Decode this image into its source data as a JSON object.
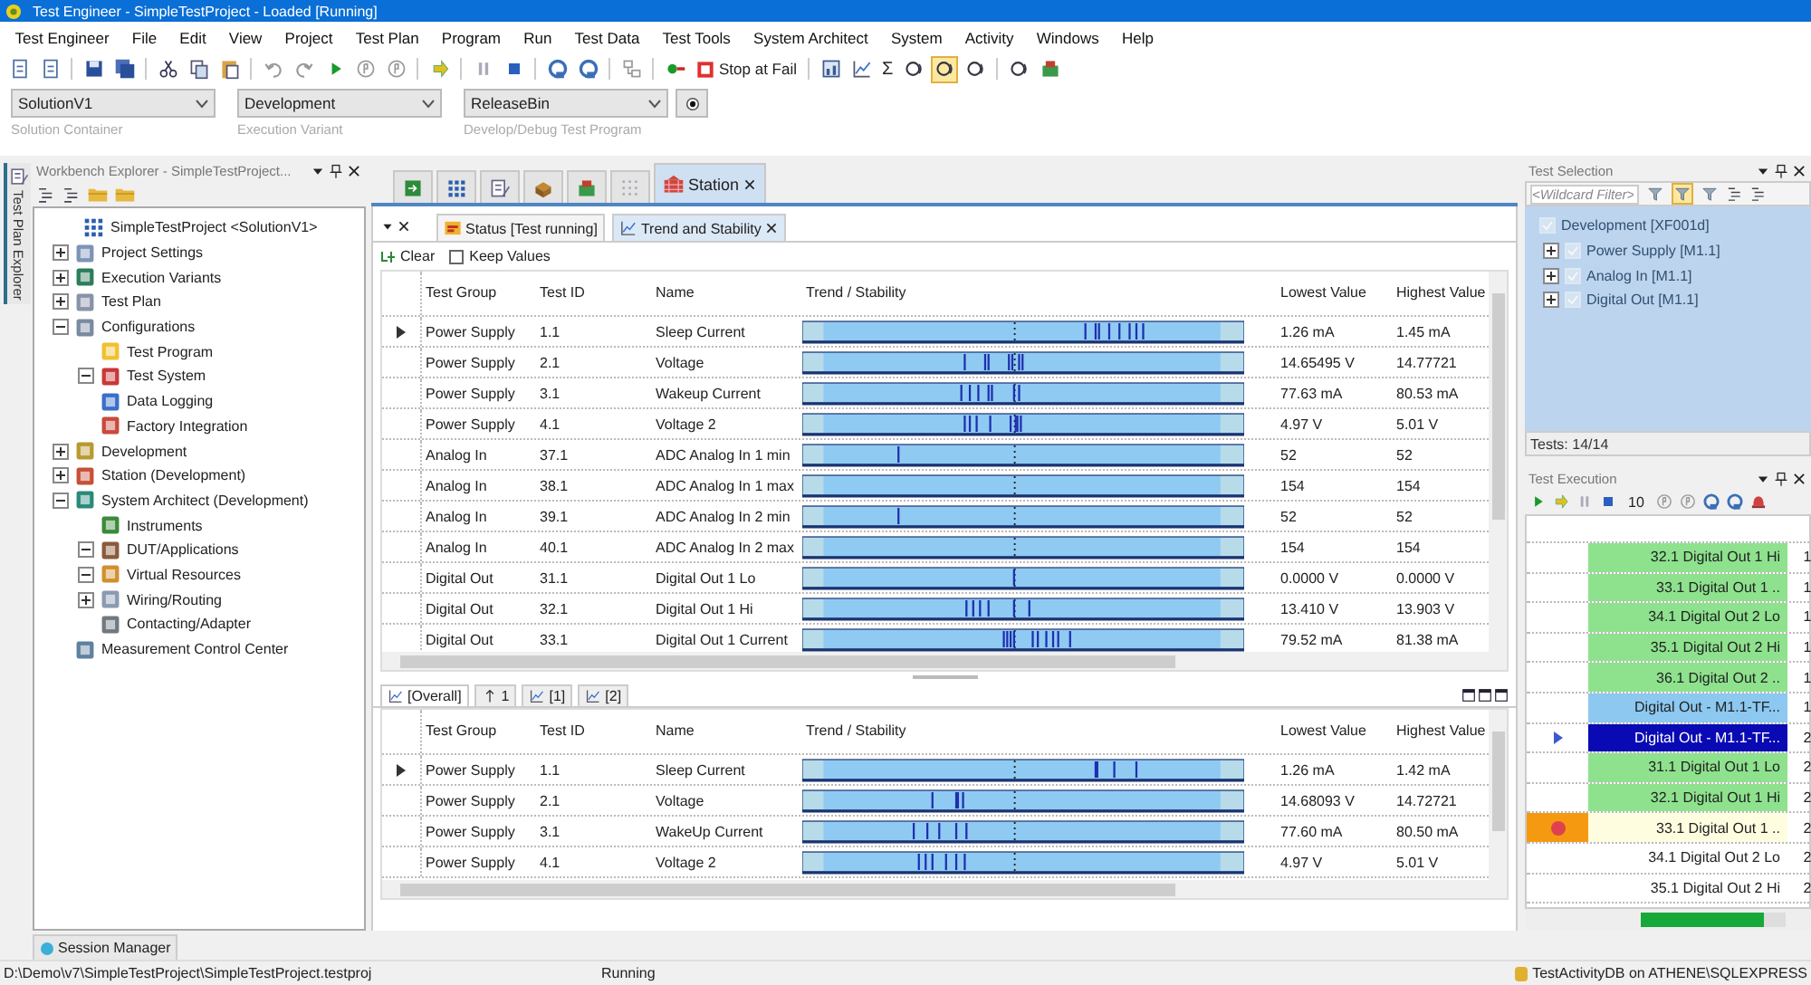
{
  "window": {
    "title": "Test Engineer - SimpleTestProject - Loaded [Running]"
  },
  "menu": [
    "Test Engineer",
    "File",
    "Edit",
    "View",
    "Project",
    "Test Plan",
    "Program",
    "Run",
    "Test Data",
    "Test Tools",
    "System Architect",
    "System",
    "Activity",
    "Windows",
    "Help"
  ],
  "toolbar": [
    {
      "kind": "doc"
    },
    {
      "kind": "doc"
    },
    {
      "kind": "sep"
    },
    {
      "kind": "save"
    },
    {
      "kind": "saveall"
    },
    {
      "kind": "sep"
    },
    {
      "kind": "cut"
    },
    {
      "kind": "copy"
    },
    {
      "kind": "paste"
    },
    {
      "kind": "sep"
    },
    {
      "kind": "undo"
    },
    {
      "kind": "redo"
    },
    {
      "kind": "play"
    },
    {
      "kind": "step"
    },
    {
      "kind": "step"
    },
    {
      "kind": "sep"
    },
    {
      "kind": "refresh"
    },
    {
      "kind": "sep"
    },
    {
      "kind": "pause"
    },
    {
      "kind": "stop"
    },
    {
      "kind": "sep"
    },
    {
      "kind": "loop"
    },
    {
      "kind": "loop"
    },
    {
      "kind": "sep"
    },
    {
      "kind": "deploy"
    },
    {
      "kind": "sep"
    },
    {
      "kind": "record"
    },
    {
      "kind": "stopfail",
      "label": "Stop at Fail"
    },
    {
      "kind": "sep"
    },
    {
      "kind": "chart"
    },
    {
      "kind": "graph"
    },
    {
      "kind": "text",
      "label": "Σ"
    },
    {
      "kind": "view",
      "pressed": false
    },
    {
      "kind": "view",
      "pressed": true
    },
    {
      "kind": "view",
      "pressed": false
    },
    {
      "kind": "sep"
    },
    {
      "kind": "view",
      "pressed": false
    },
    {
      "kind": "device"
    }
  ],
  "selectors": [
    {
      "value": "SolutionV1",
      "caption": "Solution Container"
    },
    {
      "value": "Development",
      "caption": "Execution Variant"
    },
    {
      "value": "ReleaseBin",
      "caption": "Develop/Debug Test Program"
    }
  ],
  "side_tab": "Test Plan Explorer",
  "explorer": {
    "title": "Workbench Explorer - SimpleTestProject...",
    "tree": [
      {
        "label": "SimpleTestProject <SolutionV1>",
        "kind": "grid",
        "children": [
          {
            "label": "Project Settings",
            "kind": "settings",
            "expanded": false
          },
          {
            "label": "Execution Variants",
            "kind": "variants",
            "expanded": false
          },
          {
            "label": "Test Plan",
            "kind": "plan",
            "expanded": false
          },
          {
            "label": "Configurations",
            "kind": "config",
            "expanded": true,
            "children": [
              {
                "label": "Test Program",
                "kind": "program"
              },
              {
                "label": "Test System",
                "kind": "system",
                "expanded": true
              },
              {
                "label": "Data Logging",
                "kind": "logging"
              },
              {
                "label": "Factory Integration",
                "kind": "factory"
              }
            ]
          },
          {
            "label": "Development",
            "kind": "dev",
            "expanded": false
          },
          {
            "label": "Station (Development)",
            "kind": "station",
            "expanded": false
          },
          {
            "label": "System Architect (Development)",
            "kind": "architect",
            "expanded": true,
            "children": [
              {
                "label": "Instruments",
                "kind": "instrument"
              },
              {
                "label": "DUT/Applications",
                "kind": "dut",
                "expanded": true
              },
              {
                "label": "Virtual Resources",
                "kind": "virtual",
                "expanded": true
              },
              {
                "label": "Wiring/Routing",
                "kind": "wiring",
                "expanded": false
              },
              {
                "label": "Contacting/Adapter",
                "kind": "adapter"
              }
            ]
          },
          {
            "label": "Measurement Control Center",
            "kind": "measure"
          }
        ]
      }
    ]
  },
  "doc_tabs": [
    {
      "kind": "import",
      "selected": false
    },
    {
      "kind": "grid",
      "selected": false
    },
    {
      "kind": "plan",
      "selected": false
    },
    {
      "kind": "box",
      "selected": false
    },
    {
      "kind": "device",
      "selected": false
    },
    {
      "kind": "dots",
      "selected": false
    },
    {
      "kind": "station",
      "label": "Station",
      "selected": true
    }
  ],
  "sub_tabs": [
    {
      "kind": "status",
      "label": "Status [Test running]",
      "selected": false
    },
    {
      "kind": "graph",
      "label": "Trend and Stability",
      "selected": true
    }
  ],
  "options": {
    "clear": "Clear",
    "keep_values": {
      "label": "Keep Values",
      "checked": false
    }
  },
  "columns": [
    "Test Group",
    "Test ID",
    "Name",
    "Trend / Stability",
    "Lowest Value",
    "Highest Value"
  ],
  "top_rows": [
    {
      "group": "Power Supply",
      "id": "1.1",
      "name": "Sleep Current",
      "low": "1.26 mA",
      "high": "1.45 mA",
      "selected": true
    },
    {
      "group": "Power Supply",
      "id": "2.1",
      "name": "Voltage",
      "low": "14.65495 V",
      "high": "14.77721",
      "selected": false
    },
    {
      "group": "Power Supply",
      "id": "3.1",
      "name": "Wakeup Current",
      "low": "77.63 mA",
      "high": "80.53 mA",
      "selected": false
    },
    {
      "group": "Power Supply",
      "id": "4.1",
      "name": "Voltage 2",
      "low": "4.97 V",
      "high": "5.01 V",
      "selected": false
    },
    {
      "group": "Analog In",
      "id": "37.1",
      "name": "ADC Analog In 1 min",
      "low": "52",
      "high": "52",
      "selected": false
    },
    {
      "group": "Analog In",
      "id": "38.1",
      "name": "ADC Analog In 1 max",
      "low": "154",
      "high": "154",
      "selected": false
    },
    {
      "group": "Analog In",
      "id": "39.1",
      "name": "ADC Analog In 2 min",
      "low": "52",
      "high": "52",
      "selected": false
    },
    {
      "group": "Analog In",
      "id": "40.1",
      "name": "ADC Analog In 2 max",
      "low": "154",
      "high": "154",
      "selected": false
    },
    {
      "group": "Digital Out",
      "id": "31.1",
      "name": "Digital Out 1 Lo",
      "low": "0.0000 V",
      "high": "0.0000 V",
      "selected": false
    },
    {
      "group": "Digital Out",
      "id": "32.1",
      "name": "Digital Out 1 Hi",
      "low": "13.410 V",
      "high": "13.903 V",
      "selected": false
    },
    {
      "group": "Digital Out",
      "id": "33.1",
      "name": "Digital Out 1 Current",
      "low": "79.52 mA",
      "high": "81.38 mA",
      "selected": false
    }
  ],
  "bottom_tabs": [
    {
      "kind": "graph",
      "label": "[Overall]",
      "selected": true
    },
    {
      "kind": "sort",
      "label": "1",
      "selected": false
    },
    {
      "kind": "graph",
      "label": "[1]",
      "selected": false
    },
    {
      "kind": "graph",
      "label": "[2]",
      "selected": false
    }
  ],
  "bottom_columns": [
    "Test Group",
    "Test ID",
    "Name",
    "Trend / Stability",
    "Lowest Value",
    "Highest Value"
  ],
  "bottom_rows": [
    {
      "group": "Power Supply",
      "id": "1.1",
      "name": "Sleep Current",
      "low": "1.26 mA",
      "high": "1.42 mA",
      "selected": true
    },
    {
      "group": "Power Supply",
      "id": "2.1",
      "name": "Voltage",
      "low": "14.68093 V",
      "high": "14.72721",
      "selected": false
    },
    {
      "group": "Power Supply",
      "id": "3.1",
      "name": "WakeUp Current",
      "low": "77.60 mA",
      "high": "80.50 mA",
      "selected": false
    },
    {
      "group": "Power Supply",
      "id": "4.1",
      "name": "Voltage 2",
      "low": "4.97 V",
      "high": "5.01 V",
      "selected": false
    }
  ],
  "test_selection": {
    "title": "Test Selection",
    "filter_placeholder": "<Wildcard Filter>",
    "filters": [
      {
        "pressed": false
      },
      {
        "pressed": true
      },
      {
        "pressed": false
      }
    ],
    "tree": [
      {
        "label": "Development [XF001d]",
        "checked": true,
        "children": [
          {
            "label": "Power Supply [M1.1]",
            "checked": true,
            "expanded": false
          },
          {
            "label": "Analog In [M1.1]",
            "checked": true,
            "expanded": false
          },
          {
            "label": "Digital Out [M1.1]",
            "checked": true,
            "expanded": false
          }
        ]
      }
    ],
    "footer": "Tests: 14/14"
  },
  "test_execution": {
    "title": "Test Execution",
    "counter": "10",
    "rows": [
      {
        "name": "32.1 Digital Out 1 Hi",
        "run": "1",
        "color": "#8ee28e",
        "selected": false,
        "breakpoint": false
      },
      {
        "name": "33.1 Digital Out 1 ..",
        "run": "1",
        "color": "#8ee28e",
        "selected": false,
        "breakpoint": false
      },
      {
        "name": "34.1 Digital Out 2 Lo",
        "run": "1",
        "color": "#8ee28e",
        "selected": false,
        "breakpoint": false
      },
      {
        "name": "35.1 Digital Out 2 Hi",
        "run": "1",
        "color": "#8ee28e",
        "selected": false,
        "breakpoint": false
      },
      {
        "name": "36.1 Digital Out 2 ..",
        "run": "1",
        "color": "#8ee28e",
        "selected": false,
        "breakpoint": false
      },
      {
        "name": "Digital Out - M1.1-TF...",
        "run": "1",
        "color": "#8cc8f0",
        "selected": false,
        "breakpoint": false
      },
      {
        "name": "Digital Out - M1.1-TF...",
        "run": "2",
        "color": "#0a0ab4",
        "selected": true,
        "breakpoint": false
      },
      {
        "name": "31.1 Digital Out 1 Lo",
        "run": "2",
        "color": "#8ee28e",
        "selected": false,
        "breakpoint": false
      },
      {
        "name": "32.1 Digital Out 1 Hi",
        "run": "2",
        "color": "#8ee28e",
        "selected": false,
        "breakpoint": false
      },
      {
        "name": "33.1 Digital Out 1 ..",
        "run": "2",
        "color": "#fffde0",
        "selected": false,
        "breakpoint": true
      },
      {
        "name": "34.1 Digital Out 2 Lo",
        "run": "2",
        "color": "#ffffff",
        "selected": false,
        "breakpoint": false
      },
      {
        "name": "35.1 Digital Out 2 Hi",
        "run": "2",
        "color": "#ffffff",
        "selected": false,
        "breakpoint": false
      }
    ],
    "progress": {
      "level": 0.85
    }
  },
  "session_tab": "Session Manager",
  "status_bar": {
    "path": "D:\\Demo\\v7\\SimpleTestProject\\SimpleTestProject.testproj",
    "state": "Running",
    "database": "TestActivityDB on ATHENE\\SQLEXPRESS"
  }
}
